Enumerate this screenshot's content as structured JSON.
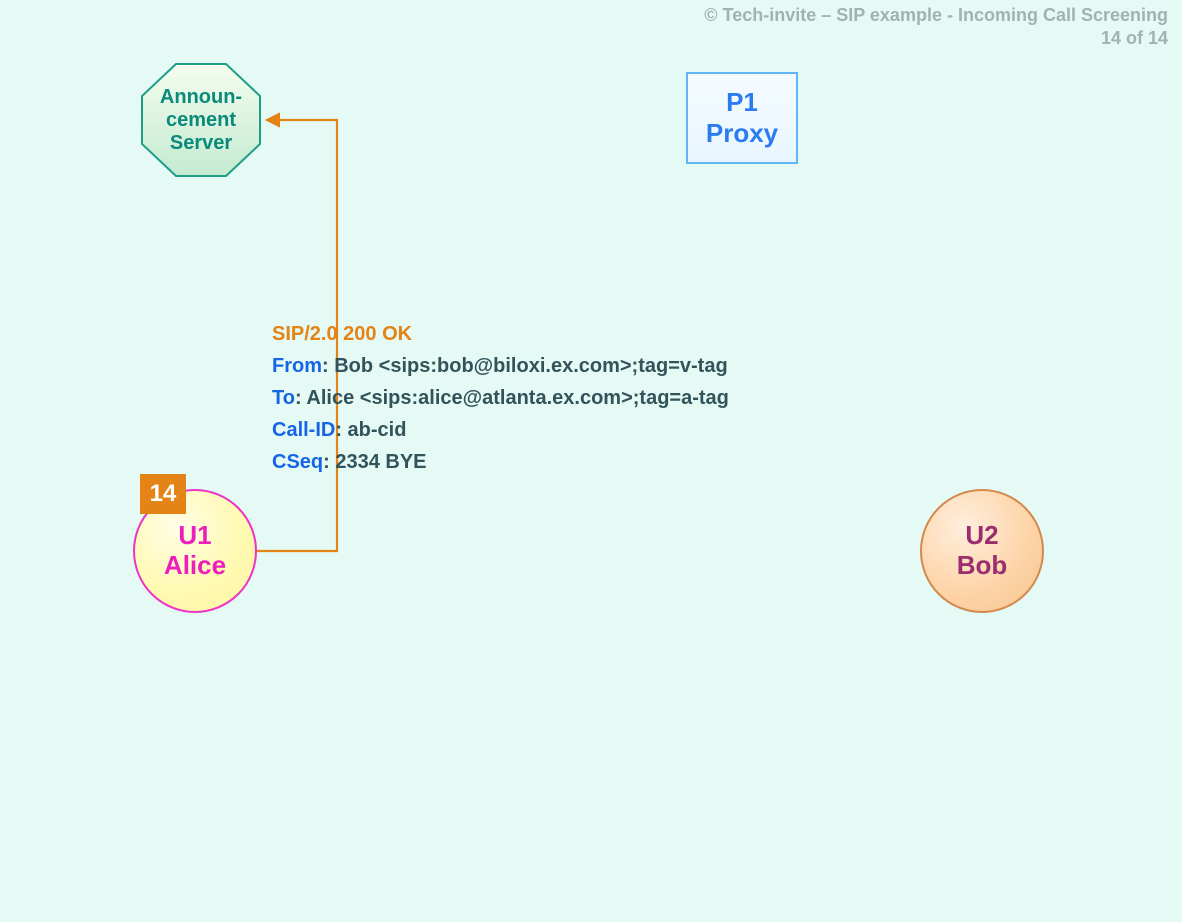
{
  "header": {
    "copyright": "© Tech-invite – SIP example - Incoming Call Screening",
    "page_indicator": "14 of 14"
  },
  "nodes": {
    "announcement_server": {
      "label": "Announ-\ncement\nServer"
    },
    "p1_proxy": {
      "label": "P1\nProxy"
    },
    "u1_alice": {
      "label": "U1\nAlice"
    },
    "u2_bob": {
      "label": "U2\nBob"
    }
  },
  "step_badge": "14",
  "sip_message": {
    "status_line": "SIP/2.0 200 OK",
    "headers": [
      {
        "key": "From",
        "value": ": Bob <sips:bob@biloxi.ex.com>;tag=v-tag"
      },
      {
        "key": "To",
        "value": ": Alice <sips:alice@atlanta.ex.com>;tag=a-tag"
      },
      {
        "key": "Call-ID",
        "value": ": ab-cid"
      },
      {
        "key": "CSeq",
        "value": ": 2334 BYE"
      }
    ]
  },
  "colors": {
    "background": "#e5f9f5",
    "header_text": "#9fb3b0",
    "orange": "#e48316",
    "blue_key": "#1565e6",
    "teal": "#0a8a7a",
    "magenta": "#ec1ebc",
    "proxy_blue": "#2b7def",
    "bob_purple": "#9c2d6f"
  }
}
